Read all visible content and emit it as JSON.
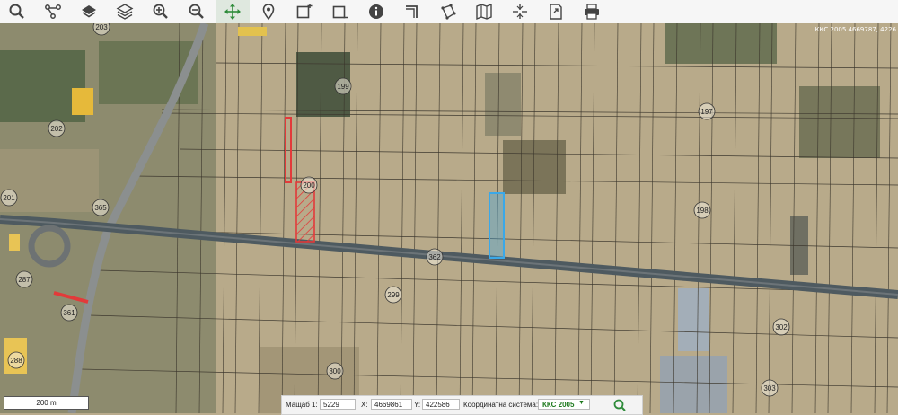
{
  "toolbar": {
    "tools": [
      {
        "name": "search-tool-icon"
      },
      {
        "name": "network-tool-icon"
      },
      {
        "name": "layer-tool-icon"
      },
      {
        "name": "layers-tool-icon"
      },
      {
        "name": "zoom-in-tool-icon"
      },
      {
        "name": "zoom-out-tool-icon"
      },
      {
        "name": "pan-tool-icon",
        "active": true
      },
      {
        "name": "marker-tool-icon"
      },
      {
        "name": "select-box-tool-icon"
      },
      {
        "name": "deselect-box-tool-icon"
      },
      {
        "name": "info-tool-icon"
      },
      {
        "name": "measure-line-tool-icon"
      },
      {
        "name": "measure-area-tool-icon"
      },
      {
        "name": "map-tool-icon"
      },
      {
        "name": "grid-tool-icon"
      },
      {
        "name": "export-tool-icon"
      },
      {
        "name": "print-tool-icon"
      }
    ]
  },
  "map": {
    "coord_readout": "ККС 2005 4669787, 4226",
    "parcel_labels": [
      "203",
      "199",
      "197",
      "202",
      "200",
      "201",
      "365",
      "198",
      "362",
      "287",
      "299",
      "361",
      "288",
      "302",
      "300",
      "303"
    ],
    "colors": {
      "highlight_red": "#e23a3a",
      "highlight_blue": "#3aa8e8",
      "road": "#4e5a60"
    }
  },
  "scalebar": {
    "label": "200 m"
  },
  "statusbar": {
    "scale_label": "Мащаб 1:",
    "scale_value": "5229",
    "x_label": "X:",
    "x_value": "4669861",
    "y_label": "Y:",
    "y_value": "422586",
    "system_label": "Координатна система:",
    "system_value": "ККС 2005"
  }
}
